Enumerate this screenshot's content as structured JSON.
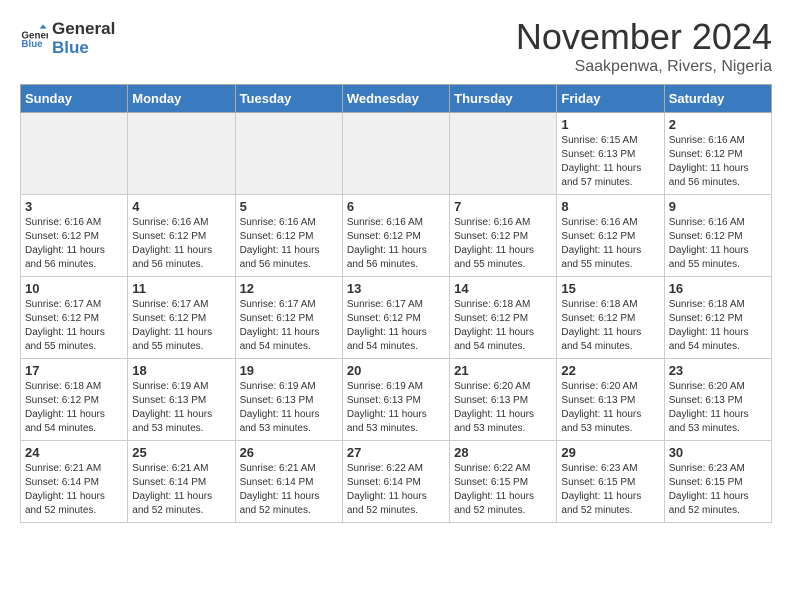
{
  "logo": {
    "line1": "General",
    "line2": "Blue"
  },
  "title": "November 2024",
  "subtitle": "Saakpenwa, Rivers, Nigeria",
  "headers": [
    "Sunday",
    "Monday",
    "Tuesday",
    "Wednesday",
    "Thursday",
    "Friday",
    "Saturday"
  ],
  "rows": [
    [
      {
        "day": "",
        "info": "",
        "empty": true
      },
      {
        "day": "",
        "info": "",
        "empty": true
      },
      {
        "day": "",
        "info": "",
        "empty": true
      },
      {
        "day": "",
        "info": "",
        "empty": true
      },
      {
        "day": "",
        "info": "",
        "empty": true
      },
      {
        "day": "1",
        "info": "Sunrise: 6:15 AM\nSunset: 6:13 PM\nDaylight: 11 hours\nand 57 minutes."
      },
      {
        "day": "2",
        "info": "Sunrise: 6:16 AM\nSunset: 6:12 PM\nDaylight: 11 hours\nand 56 minutes."
      }
    ],
    [
      {
        "day": "3",
        "info": "Sunrise: 6:16 AM\nSunset: 6:12 PM\nDaylight: 11 hours\nand 56 minutes."
      },
      {
        "day": "4",
        "info": "Sunrise: 6:16 AM\nSunset: 6:12 PM\nDaylight: 11 hours\nand 56 minutes."
      },
      {
        "day": "5",
        "info": "Sunrise: 6:16 AM\nSunset: 6:12 PM\nDaylight: 11 hours\nand 56 minutes."
      },
      {
        "day": "6",
        "info": "Sunrise: 6:16 AM\nSunset: 6:12 PM\nDaylight: 11 hours\nand 56 minutes."
      },
      {
        "day": "7",
        "info": "Sunrise: 6:16 AM\nSunset: 6:12 PM\nDaylight: 11 hours\nand 55 minutes."
      },
      {
        "day": "8",
        "info": "Sunrise: 6:16 AM\nSunset: 6:12 PM\nDaylight: 11 hours\nand 55 minutes."
      },
      {
        "day": "9",
        "info": "Sunrise: 6:16 AM\nSunset: 6:12 PM\nDaylight: 11 hours\nand 55 minutes."
      }
    ],
    [
      {
        "day": "10",
        "info": "Sunrise: 6:17 AM\nSunset: 6:12 PM\nDaylight: 11 hours\nand 55 minutes."
      },
      {
        "day": "11",
        "info": "Sunrise: 6:17 AM\nSunset: 6:12 PM\nDaylight: 11 hours\nand 55 minutes."
      },
      {
        "day": "12",
        "info": "Sunrise: 6:17 AM\nSunset: 6:12 PM\nDaylight: 11 hours\nand 54 minutes."
      },
      {
        "day": "13",
        "info": "Sunrise: 6:17 AM\nSunset: 6:12 PM\nDaylight: 11 hours\nand 54 minutes."
      },
      {
        "day": "14",
        "info": "Sunrise: 6:18 AM\nSunset: 6:12 PM\nDaylight: 11 hours\nand 54 minutes."
      },
      {
        "day": "15",
        "info": "Sunrise: 6:18 AM\nSunset: 6:12 PM\nDaylight: 11 hours\nand 54 minutes."
      },
      {
        "day": "16",
        "info": "Sunrise: 6:18 AM\nSunset: 6:12 PM\nDaylight: 11 hours\nand 54 minutes."
      }
    ],
    [
      {
        "day": "17",
        "info": "Sunrise: 6:18 AM\nSunset: 6:12 PM\nDaylight: 11 hours\nand 54 minutes."
      },
      {
        "day": "18",
        "info": "Sunrise: 6:19 AM\nSunset: 6:13 PM\nDaylight: 11 hours\nand 53 minutes."
      },
      {
        "day": "19",
        "info": "Sunrise: 6:19 AM\nSunset: 6:13 PM\nDaylight: 11 hours\nand 53 minutes."
      },
      {
        "day": "20",
        "info": "Sunrise: 6:19 AM\nSunset: 6:13 PM\nDaylight: 11 hours\nand 53 minutes."
      },
      {
        "day": "21",
        "info": "Sunrise: 6:20 AM\nSunset: 6:13 PM\nDaylight: 11 hours\nand 53 minutes."
      },
      {
        "day": "22",
        "info": "Sunrise: 6:20 AM\nSunset: 6:13 PM\nDaylight: 11 hours\nand 53 minutes."
      },
      {
        "day": "23",
        "info": "Sunrise: 6:20 AM\nSunset: 6:13 PM\nDaylight: 11 hours\nand 53 minutes."
      }
    ],
    [
      {
        "day": "24",
        "info": "Sunrise: 6:21 AM\nSunset: 6:14 PM\nDaylight: 11 hours\nand 52 minutes."
      },
      {
        "day": "25",
        "info": "Sunrise: 6:21 AM\nSunset: 6:14 PM\nDaylight: 11 hours\nand 52 minutes."
      },
      {
        "day": "26",
        "info": "Sunrise: 6:21 AM\nSunset: 6:14 PM\nDaylight: 11 hours\nand 52 minutes."
      },
      {
        "day": "27",
        "info": "Sunrise: 6:22 AM\nSunset: 6:14 PM\nDaylight: 11 hours\nand 52 minutes."
      },
      {
        "day": "28",
        "info": "Sunrise: 6:22 AM\nSunset: 6:15 PM\nDaylight: 11 hours\nand 52 minutes."
      },
      {
        "day": "29",
        "info": "Sunrise: 6:23 AM\nSunset: 6:15 PM\nDaylight: 11 hours\nand 52 minutes."
      },
      {
        "day": "30",
        "info": "Sunrise: 6:23 AM\nSunset: 6:15 PM\nDaylight: 11 hours\nand 52 minutes."
      }
    ]
  ]
}
